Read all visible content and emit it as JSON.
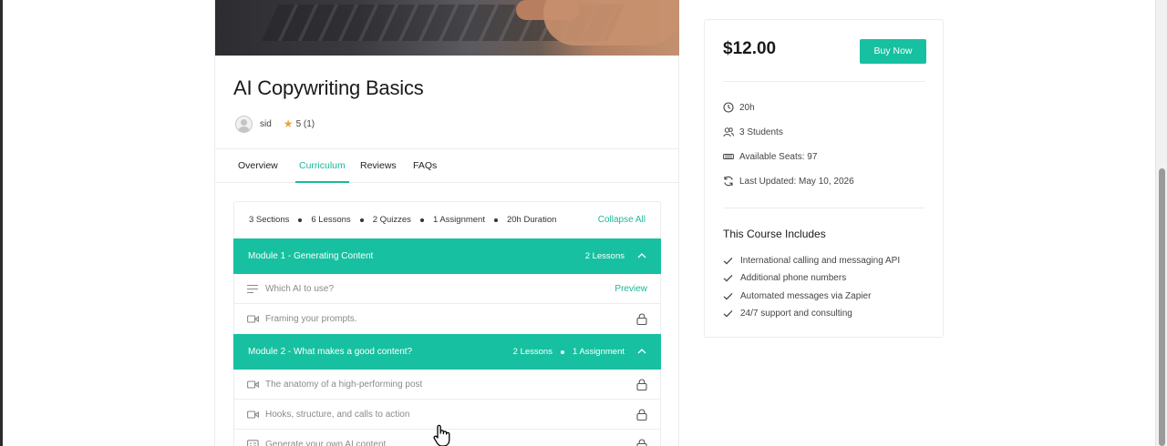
{
  "course": {
    "title": "AI Copywriting Basics",
    "author": "sid",
    "rating": "5 (1)"
  },
  "tabs": [
    {
      "label": "Overview",
      "active": false
    },
    {
      "label": "Curriculum",
      "active": true
    },
    {
      "label": "Reviews",
      "active": false
    },
    {
      "label": "FAQs",
      "active": false
    }
  ],
  "curriculum": {
    "summary": [
      "3 Sections",
      "6 Lessons",
      "2 Quizzes",
      "1 Assignment",
      "20h Duration"
    ],
    "collapse_all": "Collapse All",
    "modules": [
      {
        "title": "Module 1 - Generating Content",
        "meta": [
          "2 Lessons"
        ],
        "lessons": [
          {
            "title": "Which AI to use?",
            "icon": "text-lines-icon",
            "action": "Preview"
          },
          {
            "title": "Framing your prompts.",
            "icon": "video-icon",
            "action": "lock"
          }
        ]
      },
      {
        "title": "Module 2 - What makes a good content?",
        "meta": [
          "2 Lessons",
          "1 Assignment"
        ],
        "lessons": [
          {
            "title": "The anatomy of a high-performing post",
            "icon": "video-icon",
            "action": "lock"
          },
          {
            "title": "Hooks, structure, and calls to action",
            "icon": "video-icon",
            "action": "lock"
          },
          {
            "title": "Generate your own AI content",
            "icon": "assignment-icon",
            "action": "lock"
          }
        ]
      }
    ]
  },
  "sidebar": {
    "price": "$12.00",
    "buy_label": "Buy Now",
    "meta": {
      "duration": "20h",
      "students": "3 Students",
      "seats": "Available Seats: 97",
      "updated": "Last Updated: May 10, 2026"
    },
    "includes_title": "This Course Includes",
    "includes": [
      "International calling and messaging API",
      "Additional phone numbers",
      "Automated messages via Zapier",
      "24/7 support and consulting"
    ]
  },
  "colors": {
    "accent": "#17c0a0",
    "star": "#e9a53b"
  }
}
